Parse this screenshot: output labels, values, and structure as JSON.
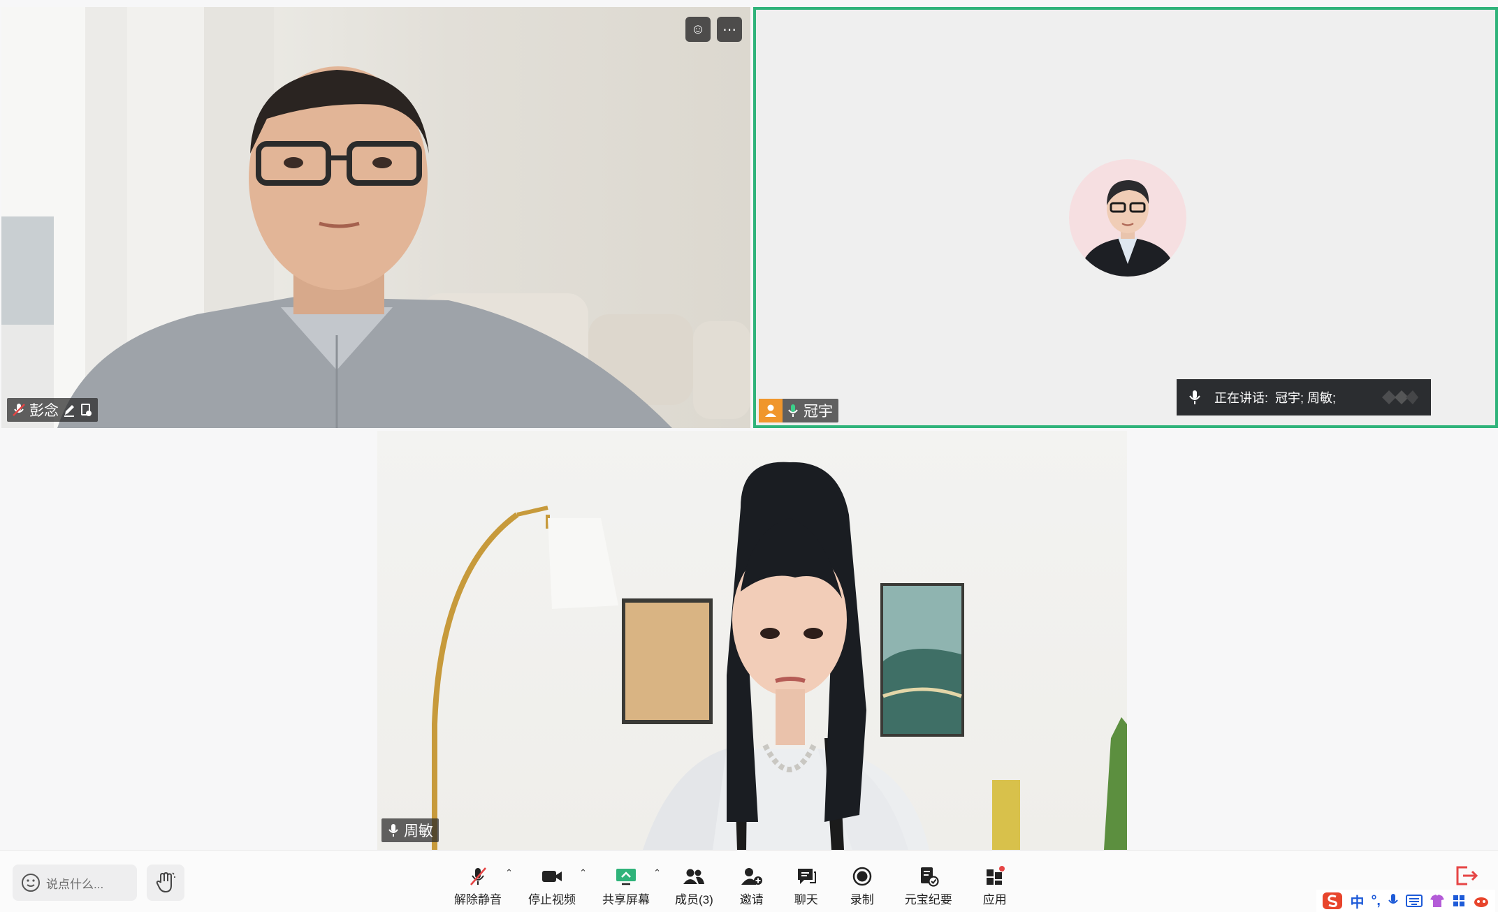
{
  "participants": [
    {
      "name": "彭念"
    },
    {
      "name": "冠宇"
    },
    {
      "name": "周敏"
    }
  ],
  "speaking": {
    "label": "正在讲话:",
    "names": "冠宇; 周敏;"
  },
  "toolbar": {
    "chat_placeholder": "说点什么...",
    "items": [
      {
        "label": "解除静音",
        "icon": "mic-off-icon"
      },
      {
        "label": "停止视频",
        "icon": "camera-icon"
      },
      {
        "label": "共享屏幕",
        "icon": "share-screen-icon"
      },
      {
        "label": "成员(3)",
        "icon": "members-icon"
      },
      {
        "label": "邀请",
        "icon": "invite-icon"
      },
      {
        "label": "聊天",
        "icon": "chat-icon"
      },
      {
        "label": "录制",
        "icon": "record-icon"
      },
      {
        "label": "元宝纪要",
        "icon": "notes-icon"
      },
      {
        "label": "应用",
        "icon": "apps-icon"
      }
    ]
  },
  "ime": {
    "mode": "中"
  },
  "colors": {
    "active_border": "#2fb37a",
    "accent_orange": "#f0962c",
    "ime_red": "#e8452c"
  }
}
